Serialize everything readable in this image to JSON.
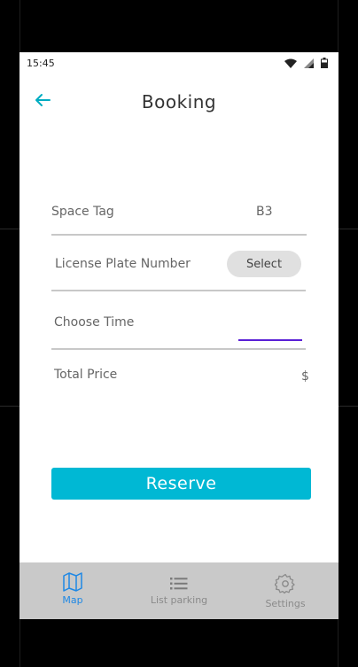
{
  "status_bar": {
    "time": "15:45"
  },
  "header": {
    "title": "Booking"
  },
  "form": {
    "space_tag_label": "Space Tag",
    "space_tag_value": "B3",
    "license_plate_label": "License Plate Number",
    "select_label": "Select",
    "choose_time_label": "Choose Time",
    "choose_time_value": "",
    "total_price_label": "Total Price",
    "total_price_value": "$"
  },
  "actions": {
    "reserve_label": "Reserve"
  },
  "bottom_nav": {
    "items": [
      {
        "label": "Map",
        "icon": "map-icon",
        "active": true
      },
      {
        "label": "List parking",
        "icon": "list-icon",
        "active": false
      },
      {
        "label": "Settings",
        "icon": "gear-icon",
        "active": false
      }
    ]
  },
  "colors": {
    "accent": "#00b8d4",
    "active_nav": "#1e88e5",
    "inactive_nav": "#8a8a8a",
    "time_underline": "#5a1fd6"
  }
}
